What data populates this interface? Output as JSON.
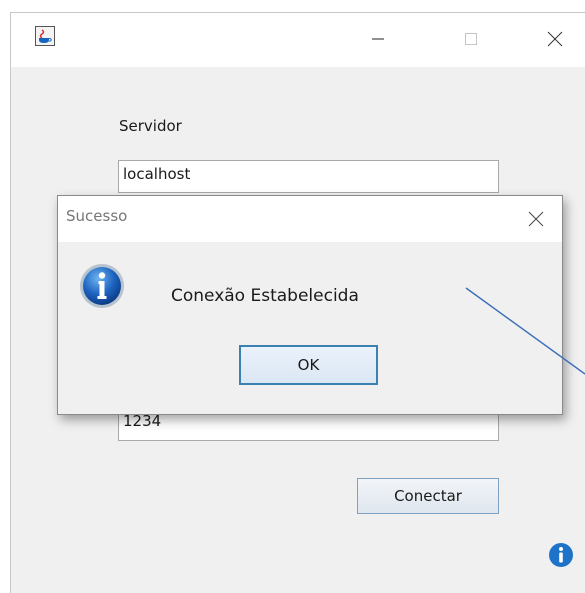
{
  "window": {
    "app_icon": "java-coffee-icon",
    "controls": {
      "minimize": "minimize-icon",
      "maximize": "maximize-icon",
      "close": "close-icon"
    }
  },
  "form": {
    "server_label": "Servidor",
    "server_value": "localhost",
    "port_value": "1234",
    "connect_button": "Conectar",
    "info_icon": "info-icon"
  },
  "dialog": {
    "title": "Sucesso",
    "message": "Conexão Estabelecida",
    "ok_button": "OK",
    "icon": "information-icon"
  },
  "colors": {
    "window_bg": "#f0f0f0",
    "button_border": "#7fa2c4",
    "info_blue": "#1e73c9",
    "focus_border": "#3c7fb1"
  }
}
